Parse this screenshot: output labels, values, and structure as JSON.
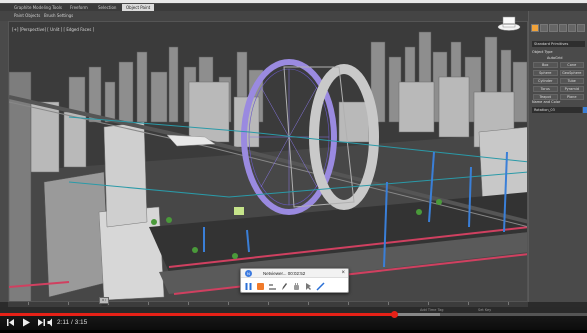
{
  "ribbon": {
    "tabs": [
      "Graphite Modeling Tools",
      "Freeform",
      "Selection",
      "Object Paint"
    ],
    "active_tab_index": 3
  },
  "subbar": {
    "items": [
      "Paint Objects",
      "Brush Settings"
    ]
  },
  "viewport": {
    "label": "[+] [Perspective] [ Unlit ] [ Edged Faces ]"
  },
  "command_panel": {
    "dropdown": "Standard Primitives",
    "object_type_header": "Object Type",
    "autogrid": "AutoGrid",
    "buttons": [
      "Box",
      "Cone",
      "Sphere",
      "GeoSphere",
      "Cylinder",
      "Tube",
      "Torus",
      "Pyramid",
      "Teapot",
      "Plane"
    ],
    "name_header": "Name and Color",
    "name_value": "Rotation_03",
    "swatch_color": "#3a7fd8"
  },
  "timeline": {
    "slider_label": "0 / 100"
  },
  "statusrow": {
    "left": "Add Time Tag",
    "right": "Set Key"
  },
  "recorder": {
    "title": "Netviewer... 00:02:52",
    "close": "×",
    "logo": "N",
    "tools": [
      "pause",
      "stop",
      "line",
      "pen",
      "hand",
      "cursor",
      "draw"
    ]
  },
  "youtube": {
    "time": "2:11 / 3:15",
    "progress_played": 0.672,
    "progress_loaded": 0.75,
    "accent": "#e62117"
  }
}
